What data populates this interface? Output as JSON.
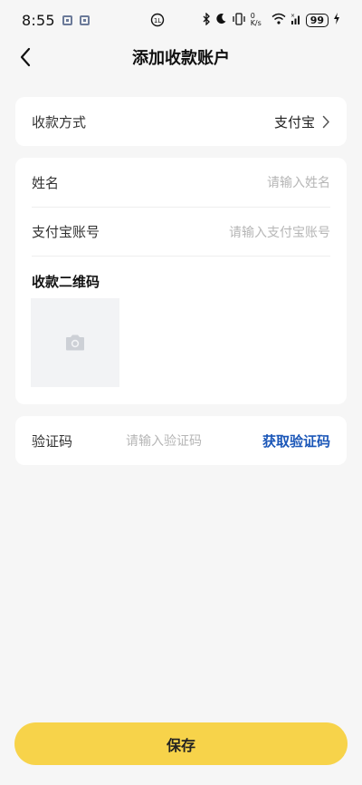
{
  "status_bar": {
    "time": "8:55",
    "network_speed": "0 K/s",
    "battery": "99"
  },
  "header": {
    "title": "添加收款账户"
  },
  "payment_method": {
    "label": "收款方式",
    "value": "支付宝"
  },
  "form": {
    "name_label": "姓名",
    "name_placeholder": "请输入姓名",
    "account_label": "支付宝账号",
    "account_placeholder": "请输入支付宝账号",
    "qr_label": "收款二维码"
  },
  "verification": {
    "label": "验证码",
    "placeholder": "请输入验证码",
    "get_code_label": "获取验证码"
  },
  "footer": {
    "save_label": "保存"
  },
  "colors": {
    "background": "#f6f6f6",
    "card": "#ffffff",
    "accent_link": "#1a56b8",
    "save_button": "#f7d34a",
    "placeholder_text": "#b6b6b6"
  },
  "icons": {
    "back": "chevron-left-icon",
    "arrow": "chevron-right-icon",
    "camera": "camera-icon"
  }
}
